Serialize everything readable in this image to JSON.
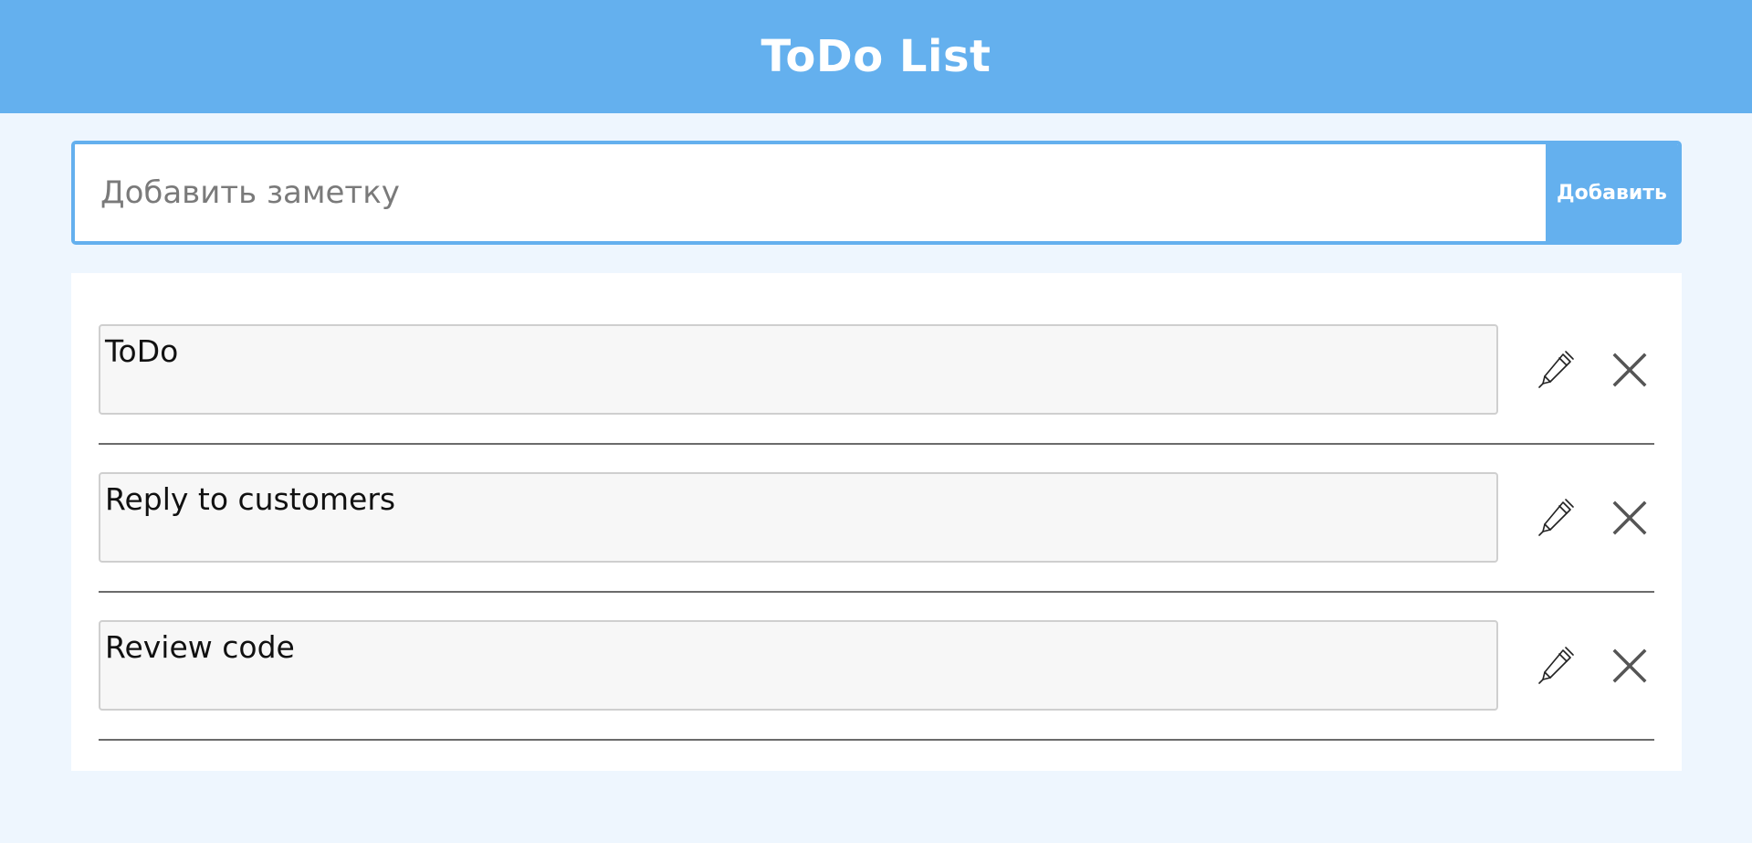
{
  "header": {
    "title": "ToDo List"
  },
  "add_form": {
    "placeholder": "Добавить заметку",
    "value": "",
    "button_label": "Добавить"
  },
  "todos": [
    {
      "text": "ToDo"
    },
    {
      "text": "Reply to customers"
    },
    {
      "text": "Review code"
    }
  ],
  "icons": {
    "edit": "pencil-icon",
    "delete": "close-icon"
  },
  "colors": {
    "accent": "#64b0ee",
    "background": "#eef6fe",
    "panel": "#ffffff",
    "item_field": "#f7f7f7"
  }
}
